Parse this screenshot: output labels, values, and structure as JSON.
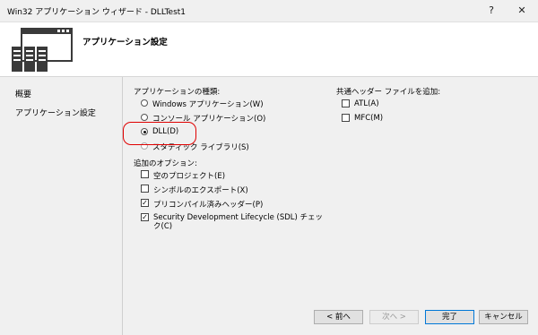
{
  "window": {
    "title": "Win32 アプリケーション ウィザード - DLLTest1",
    "help_label": "?",
    "close_label": "✕"
  },
  "header": {
    "title": "アプリケーション設定"
  },
  "sidebar": {
    "items": [
      {
        "label": "概要"
      },
      {
        "label": "アプリケーション設定"
      }
    ]
  },
  "app_type": {
    "heading": "アプリケーションの種類:",
    "options": [
      {
        "label": "Windows アプリケーション(W)",
        "selected": false
      },
      {
        "label": "コンソール アプリケーション(O)",
        "selected": false
      },
      {
        "label": "DLL(D)",
        "selected": true
      },
      {
        "label": "スタティック ライブラリ(S)",
        "selected": false
      }
    ]
  },
  "additional": {
    "heading": "追加のオプション:",
    "options": [
      {
        "label": "空のプロジェクト(E)",
        "checked": false
      },
      {
        "label": "シンボルのエクスポート(X)",
        "checked": false
      },
      {
        "label": "プリコンパイル済みヘッダー(P)",
        "checked": true
      },
      {
        "label": "Security Development Lifecycle (SDL) チェック(C)",
        "label_line1": "Security Development Lifecycle (SDL) チェッ",
        "label_line2": "ク(C)",
        "checked": true
      }
    ]
  },
  "common_headers": {
    "heading": "共通ヘッダー ファイルを追加:",
    "options": [
      {
        "label": "ATL(A)",
        "checked": false
      },
      {
        "label": "MFC(M)",
        "checked": false
      }
    ]
  },
  "buttons": {
    "prev": "< 前へ",
    "next": "次へ >",
    "finish": "完了",
    "cancel": "キャンセル"
  },
  "colors": {
    "highlight_circle": "#e00000"
  }
}
